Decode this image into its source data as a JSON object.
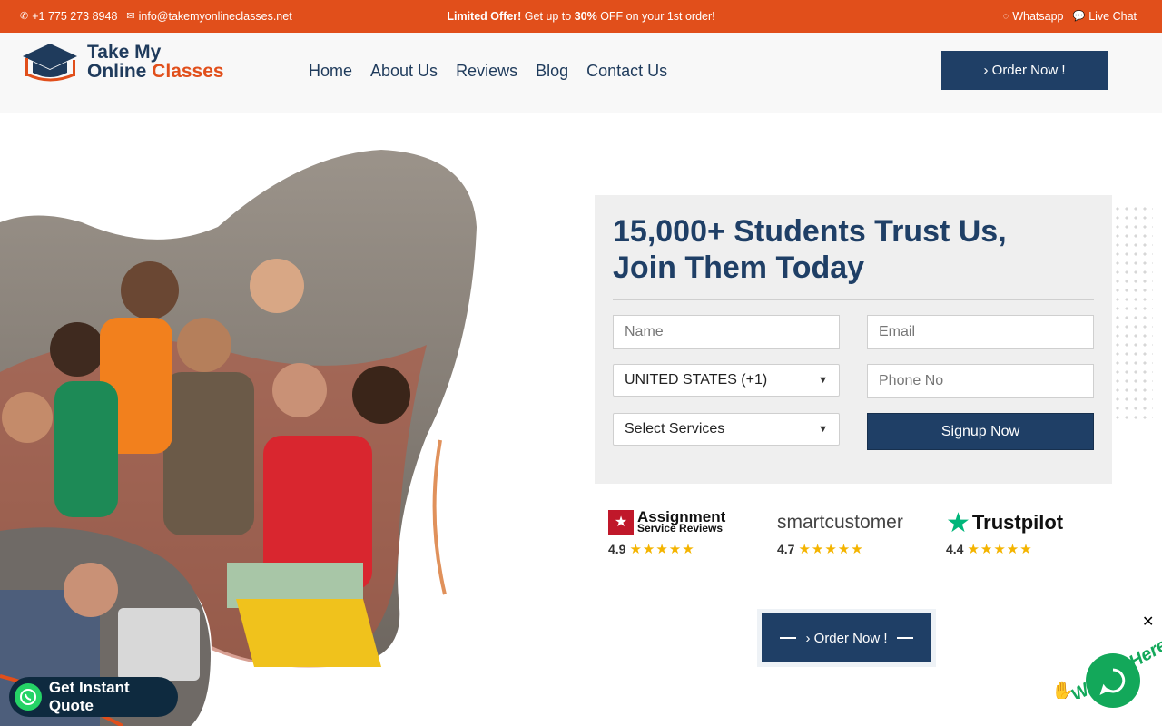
{
  "topbar": {
    "phone": "+1 775 273 8948",
    "email": "info@takemyonlineclasses.net",
    "offer_bold": "Limited Offer!",
    "offer_text_1": " Get up to ",
    "offer_pct": "30%",
    "offer_text_2": " OFF on your 1st order!",
    "whatsapp": "Whatsapp",
    "live_chat": "Live Chat"
  },
  "header": {
    "logo_line1": "Take My",
    "logo_line2a": "Online ",
    "logo_line2b": "Classes",
    "nav": [
      "Home",
      "About Us",
      "Reviews",
      "Blog",
      "Contact Us"
    ],
    "order_button": "› Order Now !"
  },
  "form": {
    "title_line1": "15,000+ Students Trust Us,",
    "title_line2": "Join Them Today",
    "name_placeholder": "Name",
    "email_placeholder": "Email",
    "country_selected": "UNITED STATES (+1)",
    "phone_placeholder": "Phone No",
    "service_selected": "Select Services",
    "signup_button": "Signup Now"
  },
  "ratings": [
    {
      "brand_line1": "Assignment",
      "brand_line2": "Service Reviews",
      "score": "4.9"
    },
    {
      "brand": "smartcustomer",
      "score": "4.7"
    },
    {
      "brand": "Trustpilot",
      "score": "4.4"
    }
  ],
  "order_mid": "› Order Now !",
  "quote_button": "Get Instant Quote",
  "chat": {
    "close": "✕",
    "tagline": "We Are Here!"
  },
  "colors": {
    "accent_orange": "#e14f1b",
    "navy": "#1f3f66",
    "green": "#13a85a"
  }
}
